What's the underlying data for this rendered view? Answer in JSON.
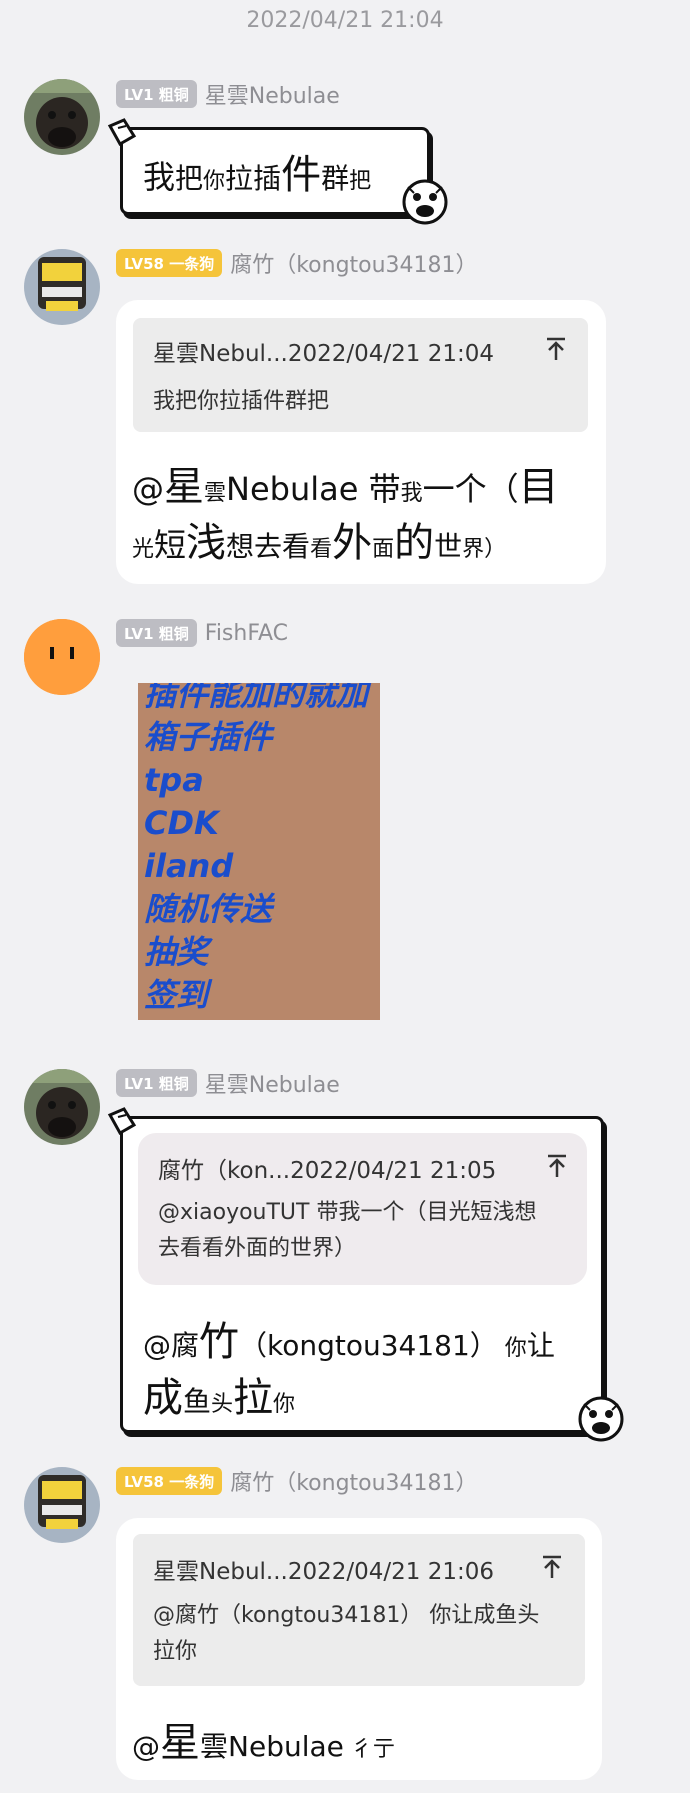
{
  "timestamp": "2022/04/21 21:04",
  "messages": [
    {
      "badge": "LV1 粗铜",
      "nick": "星雲Nebulae",
      "text_parts": [
        "我",
        "把",
        "你",
        "拉",
        "插",
        "件",
        "群",
        "把"
      ]
    },
    {
      "badge": "LV58 一条狗",
      "nick": "腐竹（kongtou34181）",
      "quote_head": "星雲Nebul...2022/04/21 21:04",
      "quote_text": "我把你拉插件群把",
      "line1": [
        "@",
        "星",
        "雲",
        "Nebulae",
        " 带",
        "我",
        "一个（",
        "目"
      ],
      "line2": [
        "光",
        "短",
        "浅",
        "想去",
        "看",
        "看",
        "外",
        "面",
        "的",
        "世",
        "界）"
      ]
    },
    {
      "badge": "LV1 粗铜",
      "nick": "FishFAC",
      "image_lines": [
        "插件能加的就加",
        "箱子插件",
        "tpa",
        "CDK",
        "iland",
        "随机传送",
        "抽奖",
        "签到"
      ]
    },
    {
      "badge": "LV1 粗铜",
      "nick": "星雲Nebulae",
      "quote_head": "腐竹（kon...2022/04/21 21:05",
      "quote_text_1": "@xiaoyouTUT 带我一个（目光短浅想",
      "quote_text_2": "去看看外面的世界）",
      "line1": [
        "@",
        "腐",
        "竹",
        "（kongtou34181）",
        " 你",
        "让"
      ],
      "line2": [
        "成",
        "鱼",
        "头",
        "拉",
        "你"
      ]
    },
    {
      "badge": "LV58 一条狗",
      "nick": "腐竹（kongtou34181）",
      "quote_head": "星雲Nebul...2022/04/21 21:06",
      "quote_text_1": "@腐竹（kongtou34181） 你让成鱼头",
      "quote_text_2": "拉你",
      "line1": [
        "@",
        "星",
        "雲",
        "Nebulae",
        " 彳",
        "亍"
      ]
    }
  ],
  "colors": {
    "background": "#f1f1f3",
    "badge_grey": "#bdbdc3",
    "badge_gold": "#f5c43a",
    "image_bg": "#b8876a",
    "image_text": "#1a4dcc"
  },
  "icons": [
    "pin-top-icon",
    "rage-face-sticker",
    "speech-bubble-ear"
  ]
}
